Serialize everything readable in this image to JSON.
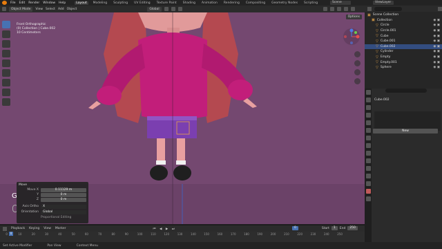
{
  "menu": {
    "items": [
      "File",
      "Edit",
      "Render",
      "Window",
      "Help"
    ]
  },
  "workspaces": [
    {
      "label": "Layout",
      "active": true
    },
    {
      "label": "Modeling",
      "active": false
    },
    {
      "label": "Sculpting",
      "active": false
    },
    {
      "label": "UV Editing",
      "active": false
    },
    {
      "label": "Texture Paint",
      "active": false
    },
    {
      "label": "Shading",
      "active": false
    },
    {
      "label": "Animation",
      "active": false
    },
    {
      "label": "Rendering",
      "active": false
    },
    {
      "label": "Compositing",
      "active": false
    },
    {
      "label": "Geometry Nodes",
      "active": false
    },
    {
      "label": "Scripting",
      "active": false
    }
  ],
  "scene": {
    "scene_label": "Scene",
    "viewlayer_label": "ViewLayer"
  },
  "header": {
    "mode": "Object Mode",
    "menus": [
      "View",
      "Select",
      "Add",
      "Object"
    ],
    "transform_orientation": "Global"
  },
  "viewport": {
    "overlay_line1": "Front Orthographic",
    "overlay_line2": "(0) Collection | Cube.002",
    "overlay_line3": "10 Centimeters",
    "options_label": "Options"
  },
  "operator_panel": {
    "title": "Move",
    "fields": [
      {
        "label": "Move X",
        "value": "0.11129 m"
      },
      {
        "label": "Y",
        "value": "0 m"
      },
      {
        "label": "Z",
        "value": "0 m"
      }
    ],
    "axis_ortho_label": "Axis Ortho",
    "axis_ortho_value": "X",
    "orientation_label": "Orientation",
    "orientation_value": "Global",
    "proportional_label": "Proportional Editing"
  },
  "key_overlay": "G",
  "timeline": {
    "menus": [
      "Playback",
      "Keying",
      "View",
      "Marker"
    ],
    "current_frame": "0",
    "start_label": "Start",
    "start_value": "1",
    "end_label": "End",
    "end_value": "250",
    "ruler": [
      "0",
      "10",
      "20",
      "30",
      "40",
      "50",
      "60",
      "70",
      "80",
      "90",
      "100",
      "110",
      "120",
      "130",
      "140",
      "150",
      "160",
      "170",
      "180",
      "190",
      "200",
      "210",
      "220",
      "230",
      "240",
      "250"
    ]
  },
  "status_bar": [
    "Set Active Modifier",
    "Pan View",
    "Context Menu"
  ],
  "outliner": {
    "items": [
      {
        "name": "Scene Collection",
        "indent": 0,
        "selected": false
      },
      {
        "name": "Collection",
        "indent": 1,
        "selected": false
      },
      {
        "name": "Circle",
        "indent": 2,
        "selected": false
      },
      {
        "name": "Circle.001",
        "indent": 2,
        "selected": false
      },
      {
        "name": "Cube",
        "indent": 2,
        "selected": false
      },
      {
        "name": "Cube.001",
        "indent": 2,
        "selected": false
      },
      {
        "name": "Cube.002",
        "indent": 2,
        "selected": true
      },
      {
        "name": "Cylinder",
        "indent": 2,
        "selected": false
      },
      {
        "name": "Empty",
        "indent": 2,
        "selected": false
      },
      {
        "name": "Empty.001",
        "indent": 2,
        "selected": false
      },
      {
        "name": "Sphere",
        "indent": 2,
        "selected": false
      }
    ]
  },
  "properties": {
    "object_name": "Cube.002",
    "new_button": "New"
  },
  "colors": {
    "accent": "#4772b3",
    "viewport_bg": "#744870",
    "body_pink": "#c21e7a",
    "skirt_purple": "#7b3fb0"
  }
}
